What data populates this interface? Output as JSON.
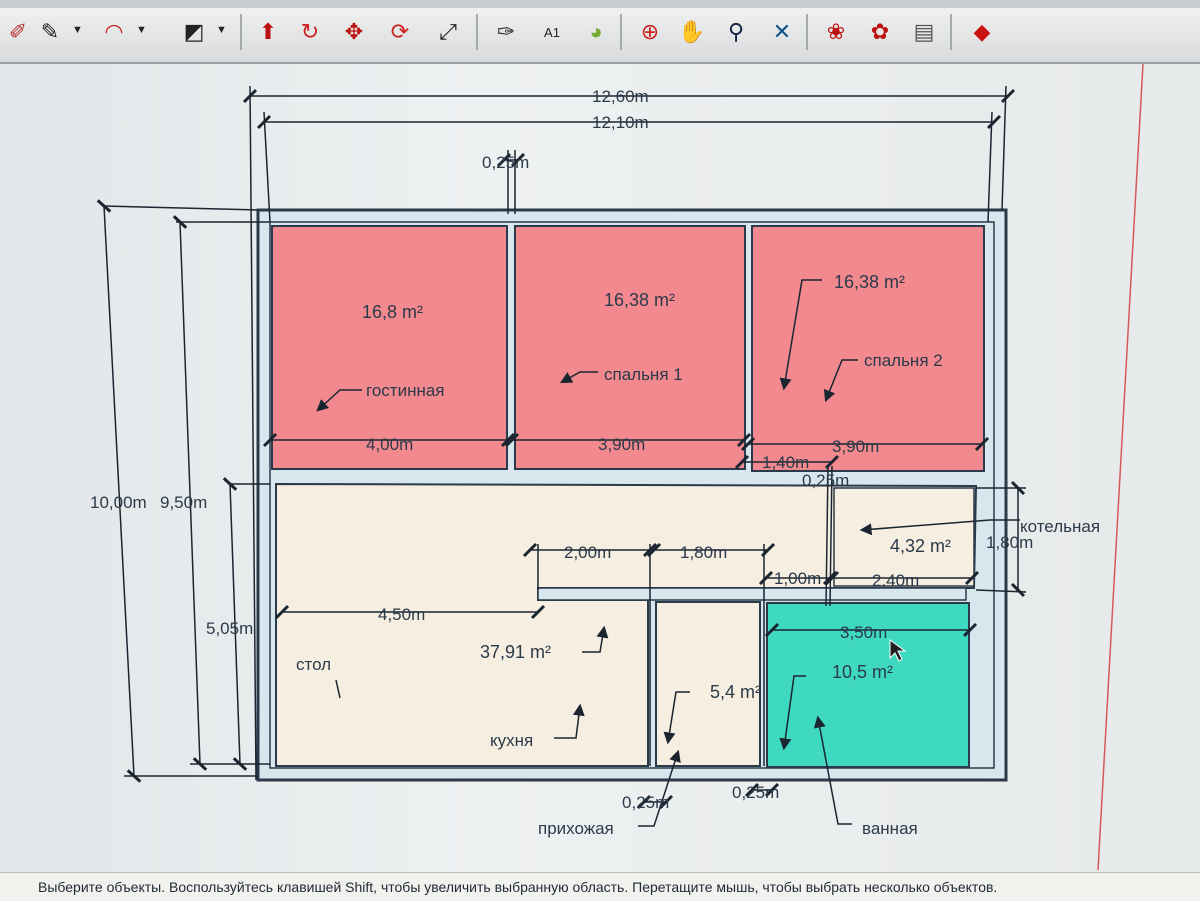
{
  "toolbar": {
    "buttons": [
      {
        "name": "eraser-icon",
        "glyph": "✐",
        "color": "#b33"
      },
      {
        "name": "pencil-icon",
        "glyph": "✎",
        "color": "#222"
      },
      {
        "name": "arc-icon",
        "glyph": "◠",
        "color": "#c22"
      },
      {
        "name": "shape-icon",
        "glyph": "◩",
        "color": "#222"
      },
      {
        "name": "pushpull-icon",
        "glyph": "⬆",
        "color": "#b11"
      },
      {
        "name": "followme-icon",
        "glyph": "↻",
        "color": "#c22"
      },
      {
        "name": "move-icon",
        "glyph": "✥",
        "color": "#b11"
      },
      {
        "name": "rotate-icon",
        "glyph": "⟳",
        "color": "#c22"
      },
      {
        "name": "scale-icon",
        "glyph": "⤢",
        "color": "#222"
      },
      {
        "name": "tape-measure-icon",
        "glyph": "✑",
        "color": "#333"
      },
      {
        "name": "text-icon",
        "glyph": "A1",
        "color": "#222"
      },
      {
        "name": "paint-bucket-icon",
        "glyph": "◕",
        "color": "#7a3"
      },
      {
        "name": "orbit-icon",
        "glyph": "⊕",
        "color": "#c22"
      },
      {
        "name": "pan-icon",
        "glyph": "✋",
        "color": "#a63"
      },
      {
        "name": "zoom-icon",
        "glyph": "⚲",
        "color": "#124"
      },
      {
        "name": "zoom-extents-icon",
        "glyph": "✕",
        "color": "#158"
      },
      {
        "name": "warehouse-icon",
        "glyph": "❀",
        "color": "#b11"
      },
      {
        "name": "components-icon",
        "glyph": "✿",
        "color": "#b11"
      },
      {
        "name": "layout-icon",
        "glyph": "▤",
        "color": "#555"
      },
      {
        "name": "ruby-icon",
        "glyph": "◆",
        "color": "#c11"
      }
    ]
  },
  "colors": {
    "bedroom_fill": "#f2898f",
    "kitchen_fill": "#f6eee0",
    "bathroom_fill": "#3fd9c2",
    "wall_fill": "#d8e6ee",
    "wall_stroke": "#2b3a4a"
  },
  "plan": {
    "areas": {
      "living": "16,8 m²",
      "bedroom1": "16,38 m²",
      "bedroom2": "16,38 m²",
      "boiler": "4,32 m²",
      "kitchen": "37,91 m²",
      "hall": "5,4 m²",
      "bath": "10,5 m²"
    },
    "labels": {
      "living": "гостинная",
      "bedroom1": "спальня 1",
      "bedroom2": "спальня 2",
      "boiler": "котельная",
      "table": "стол",
      "kitchen": "кухня",
      "hall": "прихожая",
      "bath": "ванная"
    },
    "dims": {
      "overall_outer": "12,60m",
      "overall_inner": "12,10m",
      "wall_top": "0,25m",
      "height_outer": "10,00m",
      "height_inner": "9,50m",
      "lower_height": "5,05m",
      "living_w": "4,00m",
      "bed1_w": "3,90m",
      "bed2_w": "3,90m",
      "corr_1_40": "1,40m",
      "wall_mid": "0,25m",
      "boiler_h": "1,80m",
      "dim_2_00": "2,00m",
      "dim_1_80": "1,80m",
      "dim_1_00": "1,00m",
      "dim_2_40": "2,40m",
      "dim_4_50": "4,50m",
      "bath_w": "3,50m",
      "wall_bottom_1": "0,25m",
      "wall_bottom_2": "0,25m"
    }
  },
  "status": {
    "text": "Выберите объекты. Воспользуйтесь клавишей Shift, чтобы увеличить выбранную область. Перетащите мышь, чтобы выбрать несколько объектов."
  }
}
